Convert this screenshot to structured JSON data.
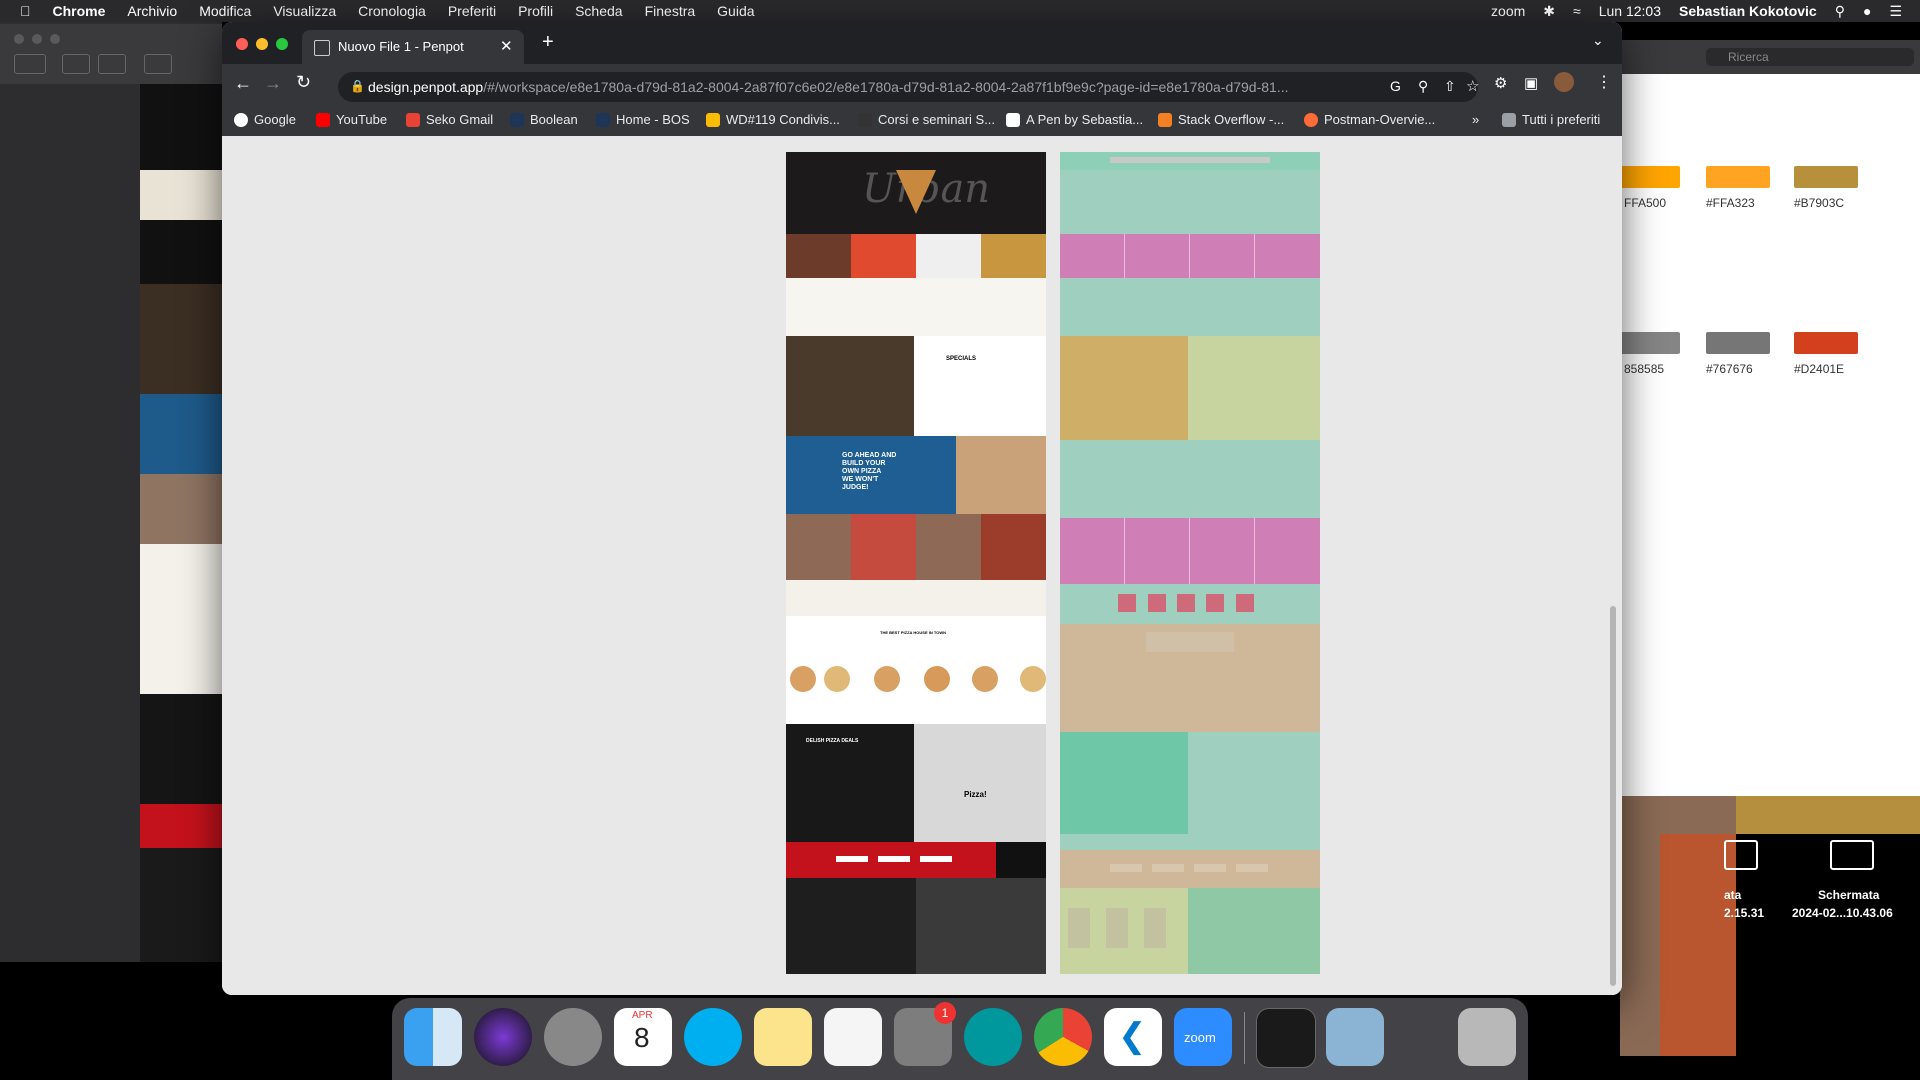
{
  "menubar": {
    "apple": "",
    "app": "Chrome",
    "items": [
      "Archivio",
      "Modifica",
      "Visualizza",
      "Cronologia",
      "Preferiti",
      "Profili",
      "Scheda",
      "Finestra",
      "Guida"
    ],
    "zoom": "zoom",
    "clock": "Lun 12:03",
    "user": "Sebastian Kokotovic"
  },
  "browser": {
    "tab_title": "Nuovo File 1 - Penpot",
    "url_domain": "design.penpot.app",
    "url_path": "/#/workspace/e8e1780a-d79d-81a2-8004-2a87f07c6e02/e8e1780a-d79d-81a2-8004-2a87f1bf9e9c?page-id=e8e1780a-d79d-81...",
    "bookmarks": [
      "Google",
      "YouTube",
      "Seko Gmail",
      "Boolean",
      "Home - BOS",
      "WD#119 Condivis...",
      "Corsi e seminari S...",
      "A Pen by Sebastia...",
      "Stack Overflow -...",
      "Postman-Overvie..."
    ],
    "bookmarks_more": "»",
    "all_bookmarks": "Tutti i preferiti"
  },
  "right_window": {
    "search_placeholder": "Ricerca",
    "swatches": [
      {
        "label": "FFA500",
        "color": "#FFA500"
      },
      {
        "label": "#FFA323",
        "color": "#FFA323"
      },
      {
        "label": "#B7903C",
        "color": "#B7903C"
      },
      {
        "label": "858585",
        "color": "#858585"
      },
      {
        "label": "#767676",
        "color": "#767676"
      },
      {
        "label": "#D2401E",
        "color": "#D2401E"
      }
    ]
  },
  "desktop": {
    "file1_line1": "ata",
    "file1_line2": "2.15.31",
    "file2_line1": "Schermata",
    "file2_line2": "2024-02...10.43.06"
  },
  "mockup": {
    "pizza_texts": [
      "GO AHEAD AND",
      "BUILD YOUR",
      "OWN PIZZA",
      "WE WON'T",
      "JUDGE!"
    ],
    "specials": "SPECIALS",
    "best_pizza": "THE BEST PIZZA HOUSE IN TOWN",
    "deals": "DELISH PIZZA DEALS",
    "comic": "Pizza!",
    "urban": "Urban"
  },
  "dock": {
    "calendar_month": "APR",
    "calendar_day": "8",
    "badge": "1",
    "zoom_label": "zoom"
  }
}
